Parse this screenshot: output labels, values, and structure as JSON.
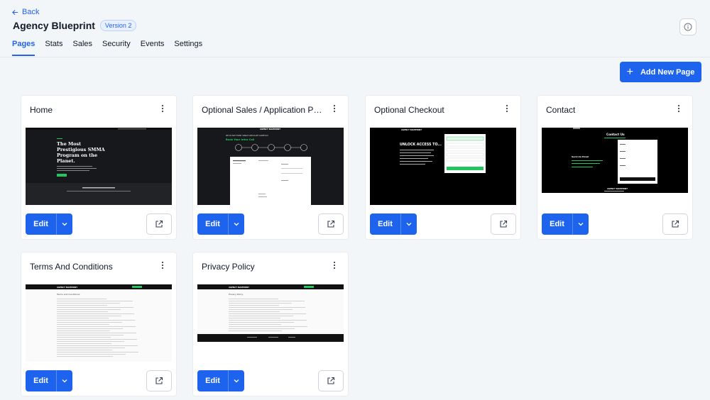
{
  "nav": {
    "back_label": "Back"
  },
  "header": {
    "title": "Agency Blueprint",
    "version_badge": "Version 2"
  },
  "tabs": [
    {
      "label": "Pages",
      "active": true
    },
    {
      "label": "Stats",
      "active": false
    },
    {
      "label": "Sales",
      "active": false
    },
    {
      "label": "Security",
      "active": false
    },
    {
      "label": "Events",
      "active": false
    },
    {
      "label": "Settings",
      "active": false
    }
  ],
  "actions": {
    "add_page_label": "Add New Page"
  },
  "pages": [
    {
      "title": "Home",
      "edit_label": "Edit",
      "thumb": {
        "headline": [
          "The Most",
          "Prestigious SMMA",
          "Program on the",
          "Planet."
        ]
      }
    },
    {
      "title": "Optional Sales / Application Page",
      "edit_label": "Edit",
      "thumb": {
        "brand": "AGENCY BLUEPRINT",
        "kicker": "WE DO NOT EVERY SINGLE APPLICANT CAREFULLY",
        "headline": "Book Your Intro Call"
      }
    },
    {
      "title": "Optional Checkout",
      "edit_label": "Edit",
      "thumb": {
        "brand": "AGENCY BLUEPRINT",
        "headline": "UNLOCK ACCESS TO..."
      }
    },
    {
      "title": "Contact",
      "edit_label": "Edit",
      "thumb": {
        "heading": "Contact Us",
        "sub": "Send An Email",
        "brand": "AGENCY BLUEPRINT"
      }
    },
    {
      "title": "Terms And Conditions",
      "edit_label": "Edit",
      "thumb": {
        "brand": "AGENCY BLUEPRINT",
        "heading": "Terms and Conditions"
      }
    },
    {
      "title": "Privacy Policy",
      "edit_label": "Edit",
      "thumb": {
        "brand": "AGENCY BLUEPRINT",
        "heading": "Privacy Policy"
      }
    }
  ],
  "icons": {
    "back": "arrow-left-icon",
    "info": "info-icon",
    "add": "plus-icon",
    "menu": "kebab-menu-icon",
    "caret": "chevron-down-icon",
    "open": "external-link-icon"
  },
  "colors": {
    "accent": "#1d63ed",
    "background": "#f3f6f9",
    "thumb_green": "#22c55e"
  }
}
